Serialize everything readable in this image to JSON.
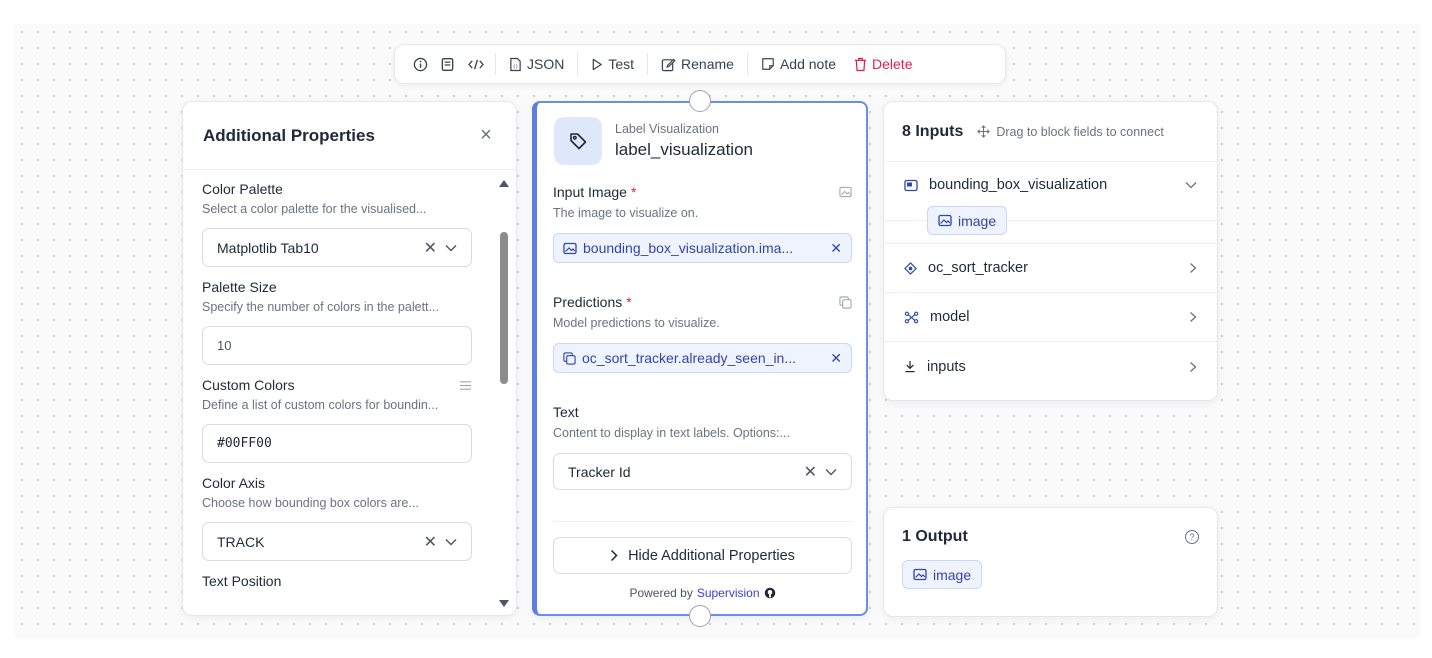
{
  "toolbar": {
    "json_label": "JSON",
    "test_label": "Test",
    "rename_label": "Rename",
    "add_note_label": "Add note",
    "delete_label": "Delete"
  },
  "additional_properties": {
    "title": "Additional Properties",
    "fields": [
      {
        "label": "Color Palette",
        "description": "Select a color palette for the visualised...",
        "value": "Matplotlib Tab10"
      },
      {
        "label": "Palette Size",
        "description": "Specify the number of colors in the palett...",
        "value": "10"
      },
      {
        "label": "Custom Colors",
        "description": "Define a list of custom colors for boundin...",
        "value": "#00FF00"
      },
      {
        "label": "Color Axis",
        "description": "Choose how bounding box colors are...",
        "value": "TRACK"
      },
      {
        "label": "Text Position"
      }
    ]
  },
  "node": {
    "type": "Label Visualization",
    "name": "label_visualization",
    "input_image": {
      "label": "Input Image",
      "required_mark": "*",
      "description": "The image to visualize on.",
      "value": "bounding_box_visualization.ima..."
    },
    "predictions": {
      "label": "Predictions",
      "required_mark": "*",
      "description": "Model predictions to visualize.",
      "value": "oc_sort_tracker.already_seen_in..."
    },
    "text": {
      "label": "Text",
      "description": "Content to display in text labels. Options:...",
      "value": "Tracker Id"
    },
    "hide_button": "Hide Additional Properties",
    "powered_by": "Powered by",
    "powered_link": "Supervision"
  },
  "inputs": {
    "title": "8 Inputs",
    "hint": "Drag to block fields to connect",
    "items": [
      {
        "name": "bounding_box_visualization",
        "sub": "image"
      },
      {
        "name": "oc_sort_tracker"
      },
      {
        "name": "model"
      },
      {
        "name": "inputs"
      }
    ]
  },
  "outputs": {
    "title": "1 Output",
    "items": [
      "image"
    ]
  },
  "colors": {
    "accent": "#5b7fe0",
    "chip_text": "#3146a8",
    "delete": "#e11d48"
  }
}
